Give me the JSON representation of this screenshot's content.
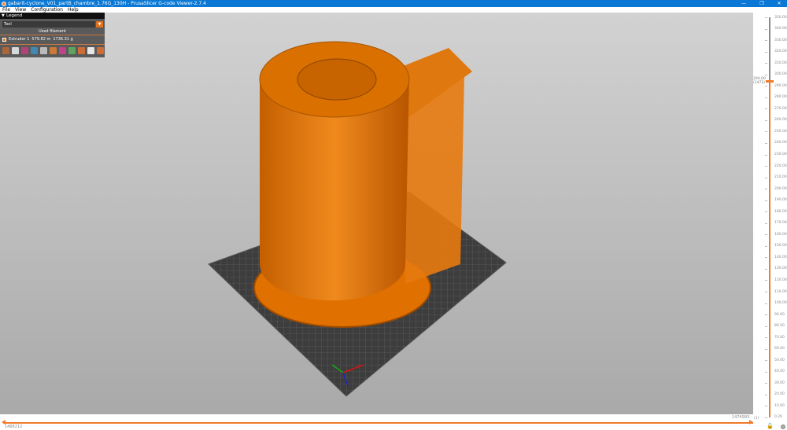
{
  "window": {
    "title": "gabarit-cyclone_V01_partB_chambre_1.76G_130H - PrusaSlicer G-code Viewer-2.7.4",
    "minimize": "—",
    "maximize": "❐",
    "close": "✕"
  },
  "menu": [
    "File",
    "View",
    "Configuration",
    "Help"
  ],
  "legend": {
    "title": "Legend",
    "view_type": "Tool",
    "used_filament_label": "Used filament",
    "extruder": {
      "name": "Extruder 1",
      "length": "579.82 m",
      "weight": "1736.31 g",
      "color": "#f07800"
    },
    "option_icons": [
      "travel-icon",
      "wipe-icon",
      "retractions-icon",
      "deretractions-icon",
      "seams-icon",
      "tool-changes-icon",
      "color-changes-icon",
      "pause-icon",
      "custom-gcode-icon",
      "center-of-gravity-icon",
      "shells-icon"
    ]
  },
  "vertical_slider": {
    "ticks": [
      "350.00",
      "340.00",
      "330.00",
      "320.00",
      "310.00",
      "300.00",
      "290.00",
      "280.00",
      "270.00",
      "260.00",
      "250.00",
      "240.00",
      "230.00",
      "220.00",
      "210.00",
      "200.00",
      "190.00",
      "180.00",
      "170.00",
      "160.00",
      "150.00",
      "140.00",
      "130.00",
      "120.00",
      "110.00",
      "100.00",
      "90.00",
      "80.00",
      "70.00",
      "60.00",
      "50.00",
      "40.00",
      "30.00",
      "20.00",
      "10.00",
      "0.20"
    ],
    "upper_value": "294.00",
    "upper_layer": "(1472)",
    "lower_value": "0.20",
    "lower_layer": "(1)",
    "max": 350,
    "upper": 294,
    "lock_icon": "lock-icon",
    "settings_icon": "cog-icon",
    "accent": "#f07a28"
  },
  "horizontal_slider": {
    "left_value": "1468212",
    "right_value": "1474993"
  }
}
